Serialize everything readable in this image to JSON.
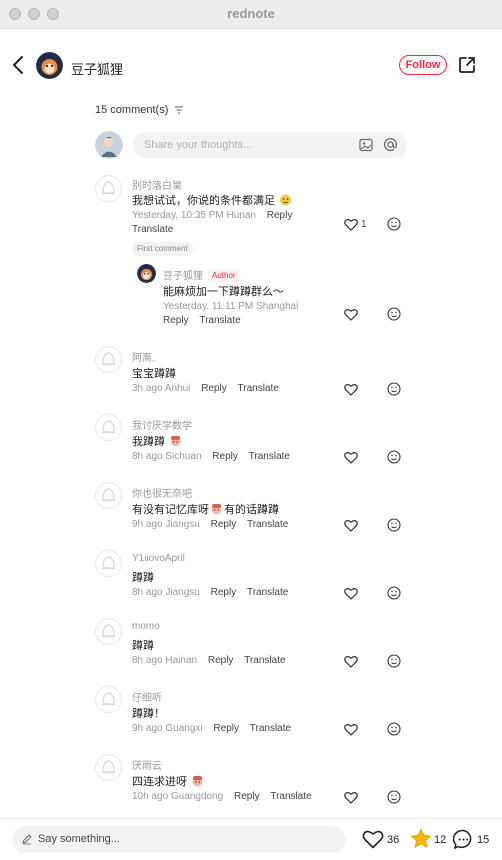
{
  "window": {
    "title": "rednote"
  },
  "header": {
    "author_name": "豆子狐狸",
    "follow_label": "Follow"
  },
  "comments_header": {
    "count_label": "15 comment(s)"
  },
  "input": {
    "placeholder": "Share your thoughts..."
  },
  "comments": [
    {
      "user": "别时落白棠",
      "text": "我想试试，你说的条件都满足",
      "time": "Yesterday, 10:35 PM",
      "location": "Hunan",
      "reply": "Reply",
      "translate": "Translate",
      "likes": "1",
      "badge": "First comment"
    },
    {
      "user": "阿离.",
      "text": "宝宝蹲蹲",
      "time": "3h ago",
      "location": "Anhui",
      "reply": "Reply",
      "translate": "Translate"
    },
    {
      "user": "我讨厌学数学",
      "text": "我蹲蹲",
      "time": "8h ago",
      "location": "Sichuan",
      "reply": "Reply",
      "translate": "Translate"
    },
    {
      "user": "你也很无奈吧",
      "text_a": "有没有记忆库呀",
      "text_b": "有的话蹲蹲",
      "time": "9h ago",
      "location": "Jiangsu",
      "reply": "Reply",
      "translate": "Translate"
    },
    {
      "user": "Y1iiovoApril",
      "text": "蹲蹲",
      "time": "8h ago",
      "location": "Jiangsu",
      "reply": "Reply",
      "translate": "Translate"
    },
    {
      "user": "momo",
      "text": "蹲蹲",
      "time": "8h ago",
      "location": "Hainan",
      "reply": "Reply",
      "translate": "Translate"
    },
    {
      "user": "仔细听",
      "text": "蹲蹲！",
      "time": "9h ago",
      "location": "Guangxi",
      "reply": "Reply",
      "translate": "Translate"
    },
    {
      "user": "厌雨云",
      "text": "四连求进呀",
      "time": "10h ago",
      "location": "Guangdong",
      "reply": "Reply",
      "translate": "Translate"
    }
  ],
  "author_reply": {
    "user": "豆子狐狸",
    "badge": "Author",
    "text": "能麻烦加一下蹲蹲群么～",
    "time": "Yesterday, 11:11 PM",
    "location": "Shanghai",
    "reply": "Reply",
    "translate": "Translate"
  },
  "bottom_bar": {
    "placeholder": "Say something...",
    "likes": "36",
    "collects": "12",
    "comments": "15"
  },
  "colors": {
    "accent": "#ff2442",
    "star": "#f5b700",
    "muted": "#999999"
  }
}
